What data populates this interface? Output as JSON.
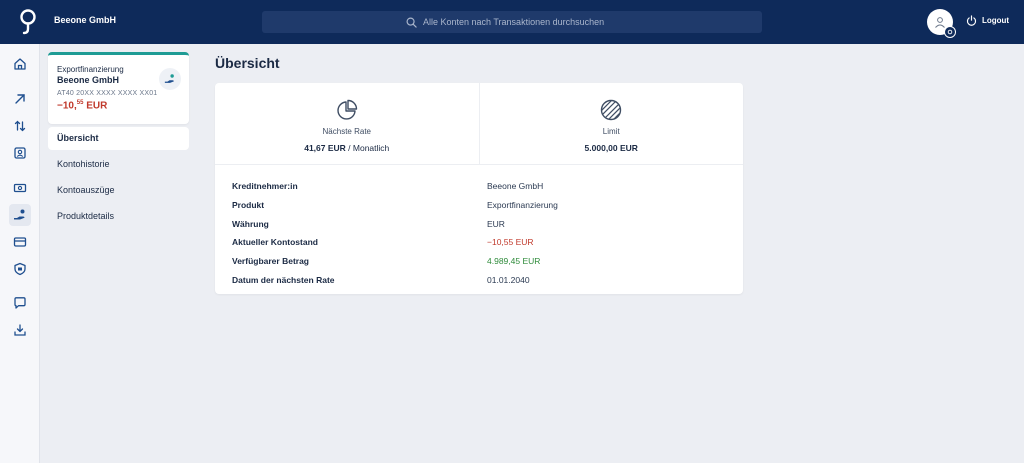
{
  "header": {
    "company_name": "Beeone GmbH",
    "search_placeholder": "Alle Konten nach Transaktionen durchsuchen",
    "logout_label": "Logout"
  },
  "rail": {
    "icons": [
      "home-icon",
      "transfer-out-icon",
      "swap-icon",
      "contacts-icon",
      "cash-icon",
      "financing-icon",
      "cards-icon",
      "security-icon",
      "chat-icon",
      "download-icon"
    ],
    "active": "financing-icon"
  },
  "account": {
    "type": "Exportfinanzierung",
    "owner": "Beeone GmbH",
    "iban": "AT40 20XX XXXX XXXX XX01",
    "balance_main": "−10,",
    "balance_cents": "55",
    "balance_currency": " EUR"
  },
  "subnav": {
    "items": [
      {
        "label": "Übersicht",
        "active": true
      },
      {
        "label": "Kontohistorie",
        "active": false
      },
      {
        "label": "Kontoauszüge",
        "active": false
      },
      {
        "label": "Produktdetails",
        "active": false
      }
    ]
  },
  "main": {
    "title": "Übersicht",
    "tiles": [
      {
        "label": "Nächste Rate",
        "value": "41,67 EUR",
        "suffix": " / Monatlich",
        "icon": "pie-chart-icon"
      },
      {
        "label": "Limit",
        "value": "5.000,00 EUR",
        "suffix": "",
        "icon": "limit-icon"
      }
    ],
    "details": [
      {
        "label": "Kreditnehmer:in",
        "value": "Beeone GmbH",
        "status": "normal"
      },
      {
        "label": "Produkt",
        "value": "Exportfinanzierung",
        "status": "normal"
      },
      {
        "label": "Währung",
        "value": "EUR",
        "status": "normal"
      },
      {
        "label": "Aktueller Kontostand",
        "value": "−10,55 EUR",
        "status": "negative"
      },
      {
        "label": "Verfügbarer Betrag",
        "value": "4.989,45 EUR",
        "status": "positive"
      },
      {
        "label": "Datum der nächsten Rate",
        "value": "01.01.2040",
        "status": "normal"
      }
    ]
  },
  "colors": {
    "header_bg": "#0e2a5a",
    "accent": "#1f9c95",
    "negative": "#c0392b",
    "positive": "#2e8b3a"
  }
}
